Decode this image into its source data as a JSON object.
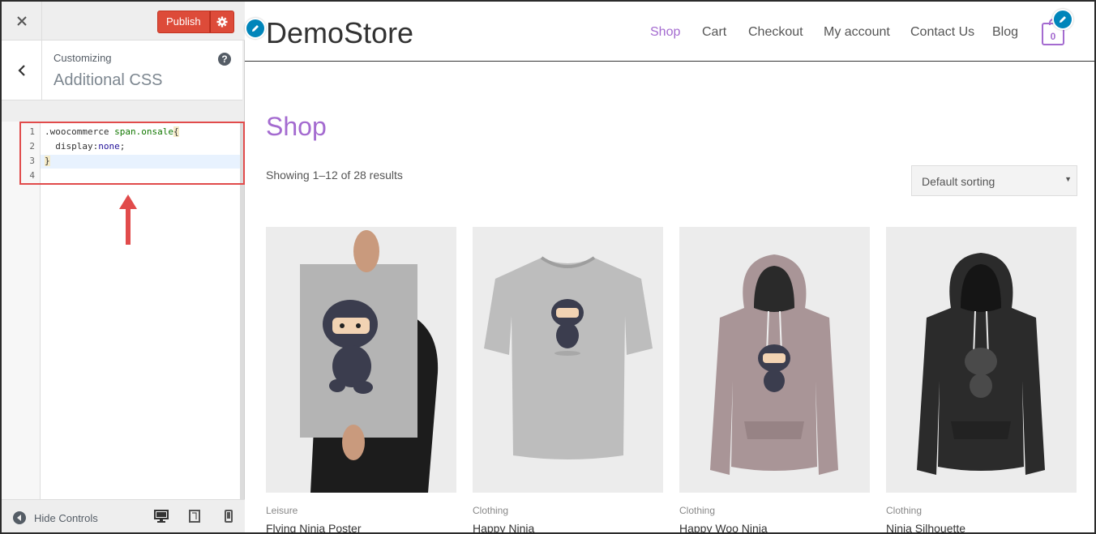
{
  "sidebar": {
    "publish_label": "Publish",
    "customizing_label": "Customizing",
    "section_title": "Additional CSS",
    "hide_controls_label": "Hide Controls"
  },
  "editor": {
    "line_numbers": [
      "1",
      "2",
      "3",
      "4"
    ],
    "lines": [
      ".woocommerce span.onsale{",
      "  display:none;",
      "}",
      ""
    ]
  },
  "site": {
    "title": "DemoStore",
    "nav": [
      "Shop",
      "Cart",
      "Checkout",
      "My account",
      "Contact Us",
      "Blog"
    ],
    "cart_count": "0",
    "accent_color": "#a46bd0",
    "edit_icon_color": "#0085ba",
    "publish_color": "#dd4b39"
  },
  "shop": {
    "title": "Shop",
    "result_count": "Showing 1–12 of 28 results",
    "sorting": "Default sorting",
    "products": [
      {
        "category": "Leisure",
        "name": "Flying Ninja Poster"
      },
      {
        "category": "Clothing",
        "name": "Happy Ninja"
      },
      {
        "category": "Clothing",
        "name": "Happy Woo Ninja"
      },
      {
        "category": "Clothing",
        "name": "Ninja Silhouette"
      }
    ]
  }
}
